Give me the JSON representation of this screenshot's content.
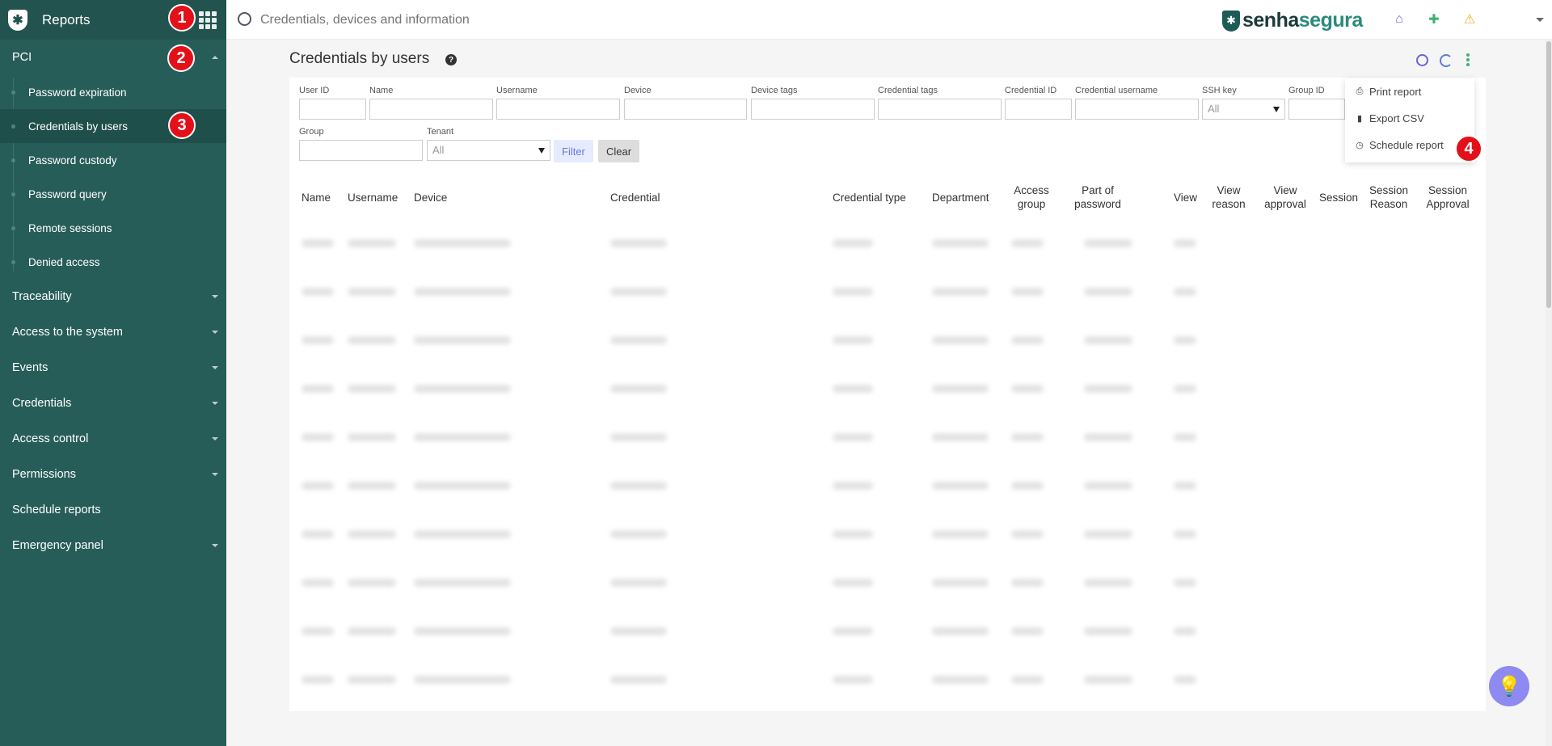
{
  "sidebar": {
    "title": "Reports",
    "sections": [
      {
        "label": "PCI",
        "expanded": true
      },
      {
        "label": "Traceability"
      },
      {
        "label": "Access to the system"
      },
      {
        "label": "Events"
      },
      {
        "label": "Credentials"
      },
      {
        "label": "Access control"
      },
      {
        "label": "Permissions"
      },
      {
        "label": "Schedule reports"
      },
      {
        "label": "Emergency panel"
      }
    ],
    "pci_items": [
      {
        "label": "Password expiration"
      },
      {
        "label": "Credentials by users",
        "active": true
      },
      {
        "label": "Password custody"
      },
      {
        "label": "Password query"
      },
      {
        "label": "Remote sessions"
      },
      {
        "label": "Denied access"
      }
    ]
  },
  "markers": [
    "1",
    "2",
    "3",
    "4"
  ],
  "search": {
    "placeholder": "Credentials, devices and information"
  },
  "brand": {
    "part1": "senha",
    "part2": "segura"
  },
  "page": {
    "title": "Credentials by users"
  },
  "filters": {
    "user_id": "User ID",
    "name": "Name",
    "username": "Username",
    "device": "Device",
    "device_tags": "Device tags",
    "credential_tags": "Credential tags",
    "credential_id": "Credential ID",
    "credential_username": "Credential username",
    "ssh_key": "SSH key",
    "ssh_key_value": "All",
    "group_id": "Group ID",
    "group": "Group",
    "tenant": "Tenant",
    "tenant_value": "All",
    "filter_button": "Filter",
    "clear_button": "Clear"
  },
  "table": {
    "columns": [
      "Name",
      "Username",
      "Device",
      "Credential",
      "Credential type",
      "Department",
      "Access group",
      "Part of password",
      "View",
      "View reason",
      "View approval",
      "Session",
      "Session Reason",
      "Session Approval"
    ]
  },
  "menu": {
    "print": "Print report",
    "export": "Export CSV",
    "schedule": "Schedule report"
  },
  "colors": {
    "sidebar": "#275d59",
    "sidebar_header": "#22534f",
    "accent": "#6a64d8",
    "marker": "#e3101a"
  }
}
